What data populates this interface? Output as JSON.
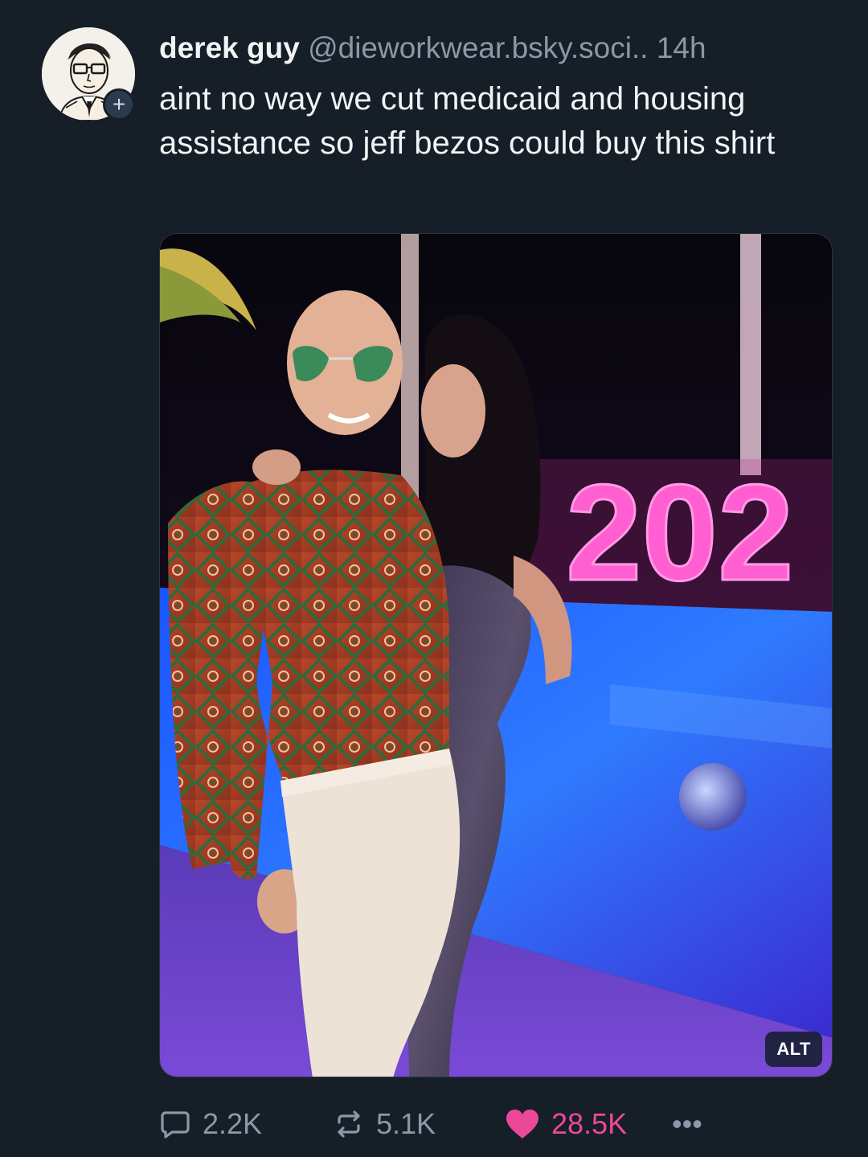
{
  "post": {
    "display_name": "derek guy",
    "handle": "@dieworkwear.bsky.soci..",
    "time": "14h",
    "text": "aint no way we cut medicaid and housing assistance so jeff bezos could buy this shirt",
    "follow_label": "+",
    "avatar_icon": "illustrated-man-with-glasses-avatar"
  },
  "media": {
    "alt_label": "ALT",
    "sign_text": "202"
  },
  "actions": {
    "reply_count": "2.2K",
    "repost_count": "5.1K",
    "like_count": "28.5K",
    "more_label": "•••",
    "reply_icon": "speech-bubble-icon",
    "repost_icon": "repost-arrows-icon",
    "like_icon": "heart-icon",
    "more_icon": "ellipsis-icon"
  },
  "colors": {
    "background": "#161e27",
    "text": "#f1f3f5",
    "muted": "#8b98a8",
    "like": "#ec4899"
  }
}
